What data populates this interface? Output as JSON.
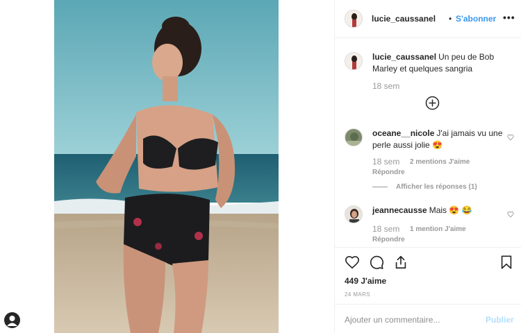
{
  "post": {
    "author": "lucie_caussanel",
    "follow_label": "S'abonner",
    "more_label": "•••",
    "separator": "•"
  },
  "caption": {
    "username": "lucie_caussanel",
    "text": "Un peu de Bob Marley et quelques sangria",
    "time": "18 sem"
  },
  "comments": [
    {
      "username": "oceane__nicole",
      "text": "J'ai jamais vu une perle aussi jolie 😍",
      "time": "18 sem",
      "likes": "2 mentions J'aime",
      "reply": "Répondre",
      "view_replies": "Afficher les réponses (1)"
    },
    {
      "username": "jeannecausse",
      "text": "Mais 😍 😂",
      "time": "18 sem",
      "likes": "1 mention J'aime",
      "reply": "Répondre"
    }
  ],
  "stats": {
    "likes": "449 J'aime",
    "date": "24 MARS"
  },
  "composer": {
    "placeholder": "Ajouter un commentaire...",
    "publish": "Publier"
  },
  "colors": {
    "accent": "#3897f0",
    "publish_disabled": "#b2dffc",
    "muted": "#999999",
    "border": "#efefef"
  },
  "icons": [
    "heart-icon",
    "comment-icon",
    "share-icon",
    "bookmark-icon",
    "more-icon",
    "plus-circle-icon",
    "heart-small-icon"
  ]
}
